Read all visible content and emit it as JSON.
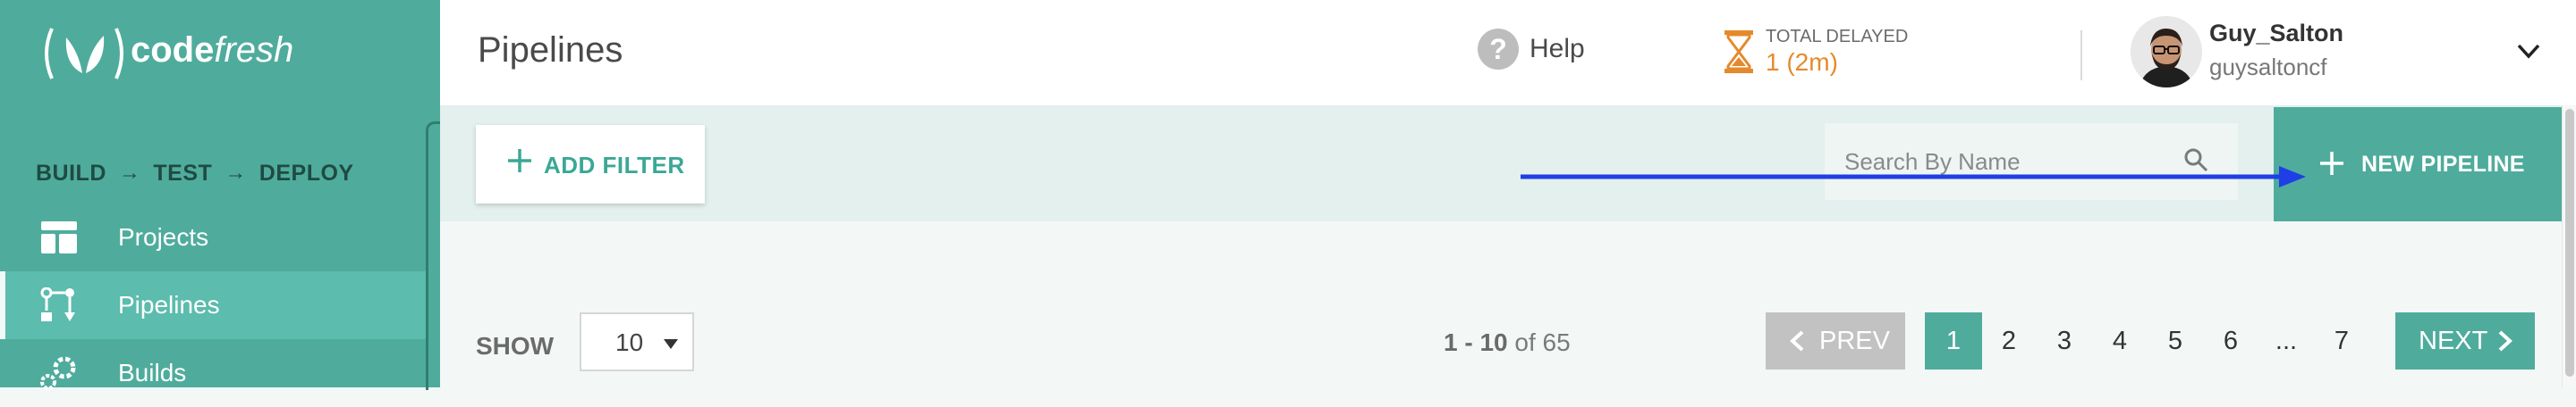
{
  "app": {
    "logo_text_bold": "code",
    "logo_text_light": "fresh",
    "accent_color": "#4fac9c",
    "delay_color": "#e58a2c"
  },
  "sidebar": {
    "flow": [
      "BUILD",
      "TEST",
      "DEPLOY"
    ],
    "flow_separator": "→",
    "items": [
      {
        "label": "Projects",
        "icon": "projects-icon",
        "active": false
      },
      {
        "label": "Pipelines",
        "icon": "pipelines-icon",
        "active": true
      },
      {
        "label": "Builds",
        "icon": "builds-gear-icon",
        "active": false
      }
    ]
  },
  "header": {
    "title": "Pipelines",
    "help_label": "Help",
    "delay_title": "TOTAL DELAYED",
    "delay_value": "1 (2m)",
    "user_name": "Guy_Salton",
    "user_handle": "guysaltoncf"
  },
  "toolbar": {
    "add_filter_label": "ADD FILTER",
    "search_placeholder": "Search By Name",
    "search_value": "",
    "new_pipeline_label": "NEW PIPELINE"
  },
  "pagination": {
    "show_label": "SHOW",
    "page_size": "10",
    "range_text": "1 - 10",
    "range_of": "of 65",
    "prev_label": "PREV",
    "next_label": "NEXT",
    "pages": [
      "1",
      "2",
      "3",
      "4",
      "5",
      "6",
      "...",
      "7"
    ],
    "current_page": "1"
  }
}
